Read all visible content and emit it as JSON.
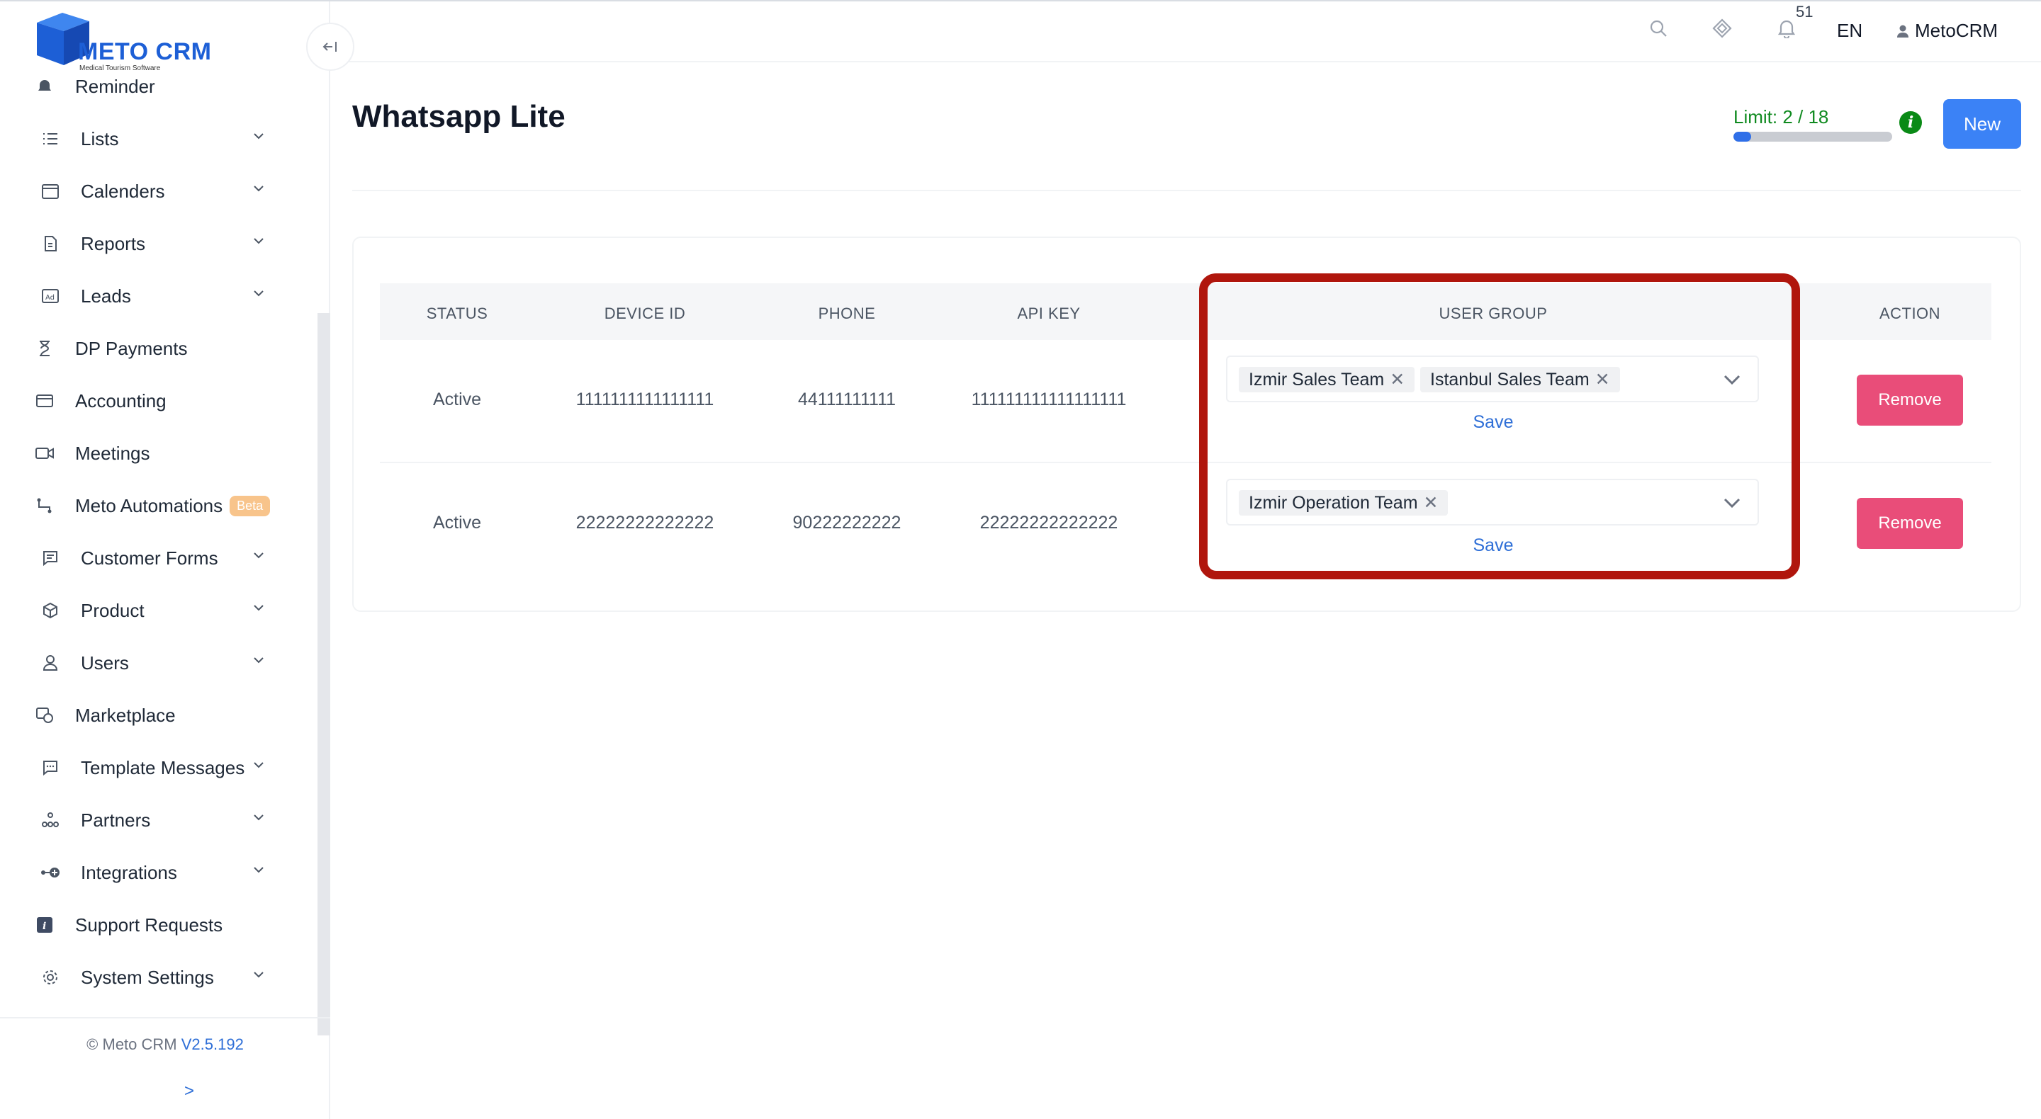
{
  "brand": {
    "name": "METO CRM",
    "tagline": "Medical Tourism Software",
    "color": "#1d5fd6"
  },
  "sidebar": {
    "items": [
      {
        "label": "Reminder",
        "icon": "bell-icon",
        "has_chevron": false
      },
      {
        "label": "Lists",
        "icon": "list-icon",
        "has_chevron": true
      },
      {
        "label": "Calenders",
        "icon": "calendar-icon",
        "has_chevron": true
      },
      {
        "label": "Reports",
        "icon": "document-icon",
        "has_chevron": true
      },
      {
        "label": "Leads",
        "icon": "ad-icon",
        "has_chevron": true
      },
      {
        "label": "DP Payments",
        "icon": "hourglass-icon",
        "has_chevron": false
      },
      {
        "label": "Accounting",
        "icon": "card-icon",
        "has_chevron": false
      },
      {
        "label": "Meetings",
        "icon": "video-icon",
        "has_chevron": false
      },
      {
        "label": "Meto Automations",
        "icon": "flow-icon",
        "has_chevron": false,
        "badge": "Beta"
      },
      {
        "label": "Customer Forms",
        "icon": "form-icon",
        "has_chevron": true
      },
      {
        "label": "Product",
        "icon": "box-icon",
        "has_chevron": true
      },
      {
        "label": "Users",
        "icon": "user-icon",
        "has_chevron": true
      },
      {
        "label": "Marketplace",
        "icon": "marketplace-icon",
        "has_chevron": false
      },
      {
        "label": "Template Messages",
        "icon": "message-icon",
        "has_chevron": true
      },
      {
        "label": "Partners",
        "icon": "partners-icon",
        "has_chevron": true
      },
      {
        "label": "Integrations",
        "icon": "plug-icon",
        "has_chevron": true
      },
      {
        "label": "Support Requests",
        "icon": "info-square-icon",
        "has_chevron": false
      },
      {
        "label": "System Settings",
        "icon": "gear-icon",
        "has_chevron": true
      }
    ],
    "footer": {
      "copyright": "© Meto CRM",
      "version": "V2.5.192",
      "expand": ">"
    }
  },
  "header": {
    "notification_count": "51",
    "language": "EN",
    "user_name": "MetoCRM"
  },
  "page": {
    "title": "Whatsapp Lite",
    "limit_text": "Limit: 2 / 18",
    "limit_used": 2,
    "limit_total": 18,
    "new_button": "New"
  },
  "table": {
    "headers": [
      "STATUS",
      "DEVICE ID",
      "PHONE",
      "API KEY",
      "USER GROUP",
      "ACTION"
    ],
    "rows": [
      {
        "status": "Active",
        "device_id": "1111111111111111",
        "phone": "44111111111",
        "api_key": "111111111111111111",
        "user_groups": [
          "Izmir Sales Team",
          "Istanbul Sales Team"
        ],
        "save": "Save",
        "action": "Remove"
      },
      {
        "status": "Active",
        "device_id": "22222222222222",
        "phone": "90222222222",
        "api_key": "22222222222222",
        "user_groups": [
          "Izmir Operation Team"
        ],
        "save": "Save",
        "action": "Remove"
      }
    ]
  },
  "colors": {
    "primary": "#3b82f6",
    "danger": "#e94d79",
    "success": "#0f8a1f",
    "highlight": "#b0160d"
  }
}
